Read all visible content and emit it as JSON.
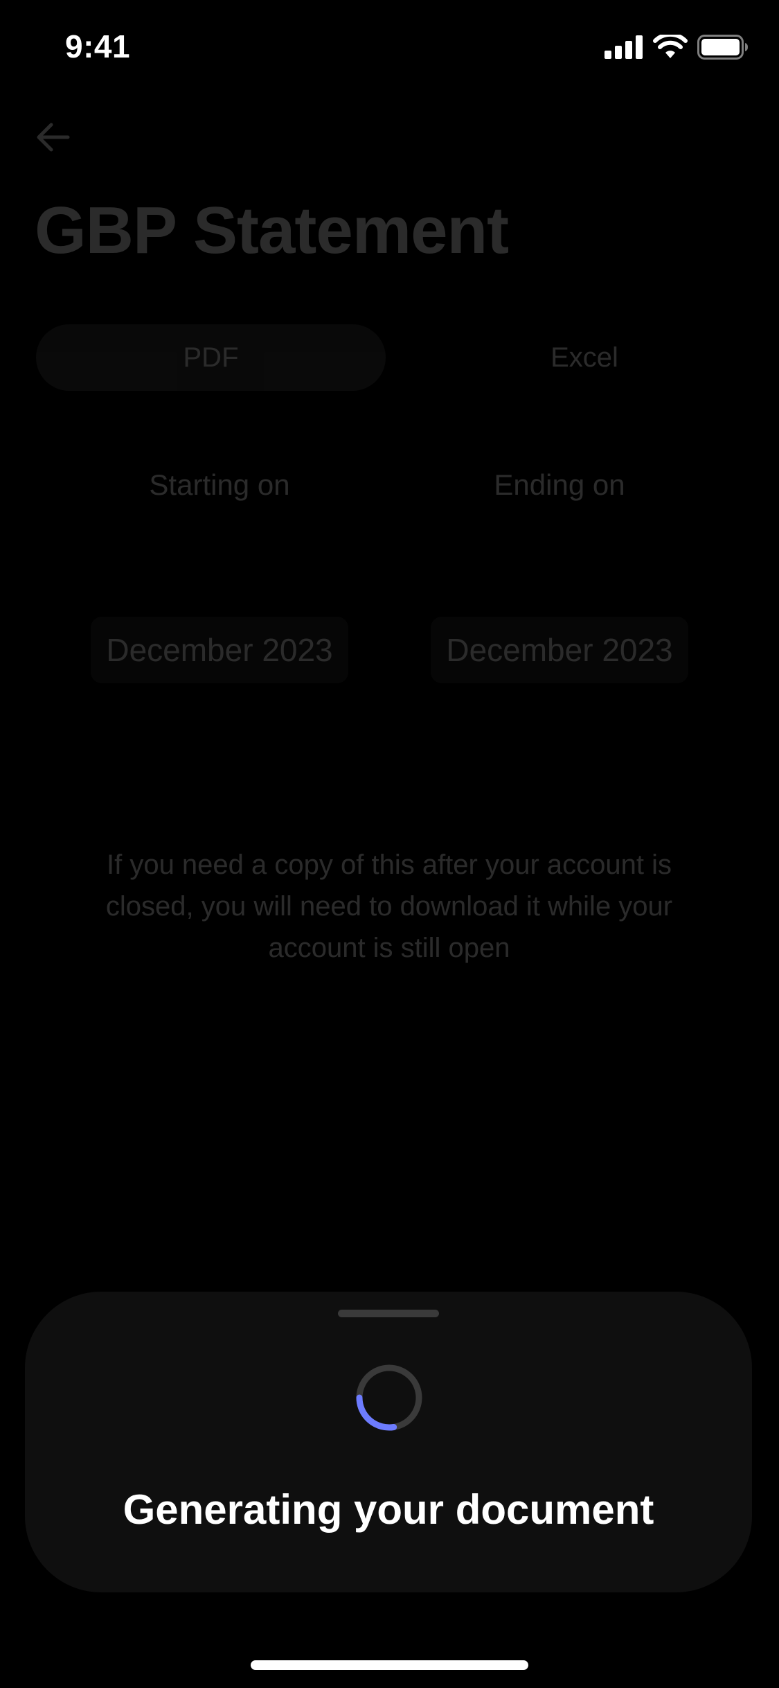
{
  "status_bar": {
    "time": "9:41",
    "icons": [
      "cellular-signal-icon",
      "wifi-icon",
      "battery-icon"
    ]
  },
  "header": {
    "back_icon": "arrow-left-icon",
    "title": "GBP Statement"
  },
  "format_selector": {
    "options": [
      {
        "label": "PDF",
        "selected": true
      },
      {
        "label": "Excel",
        "selected": false
      }
    ]
  },
  "date_range": {
    "start": {
      "label": "Starting on",
      "value": "December 2023"
    },
    "end": {
      "label": "Ending on",
      "value": "December 2023"
    }
  },
  "info": {
    "text": "If you need a copy of this after your account is closed, you will need to download it while your account is still open"
  },
  "loading_sheet": {
    "title": "Generating your document",
    "spinner_icon": "loading-spinner-icon",
    "colors": {
      "accent": "#6d7cff",
      "track": "#3a3a3a",
      "background": "#0f0f0f"
    }
  }
}
